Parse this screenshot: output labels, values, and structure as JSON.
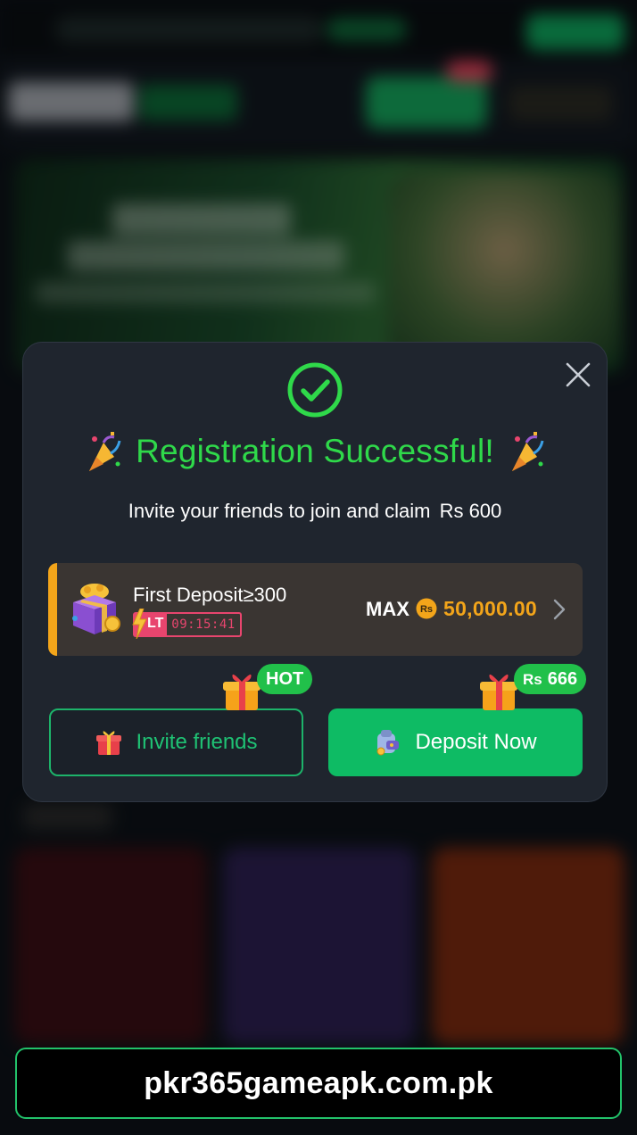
{
  "modal": {
    "title": "Registration Successful!",
    "subtitle": "Invite your friends to join and claim",
    "subtitle_amount": "Rs 600",
    "promo": {
      "name": "First Deposit≥300",
      "lt_label": "LT",
      "timer": "09:15:41",
      "max_label": "MAX",
      "coin_symbol": "Rs",
      "amount": "50,000.00"
    },
    "invite_button": {
      "label": "Invite friends",
      "tag": "HOT"
    },
    "deposit_button": {
      "label": "Deposit Now",
      "tag_symbol": "Rs",
      "tag_amount": "666"
    },
    "icons": {
      "success": "check-circle-icon",
      "close": "close-icon",
      "celebration": "party-popper-icon",
      "gift": "gift-icon",
      "wallet": "wallet-icon",
      "chevron": "chevron-right-icon"
    }
  },
  "footer": {
    "url": "pkr365gameapk.com.pk"
  },
  "colors": {
    "success_green": "#2fd94a",
    "accent_orange": "#f3a51a",
    "button_green": "#0ebb64",
    "timer_pink": "#e8456e",
    "modal_bg": "#1f252e"
  }
}
